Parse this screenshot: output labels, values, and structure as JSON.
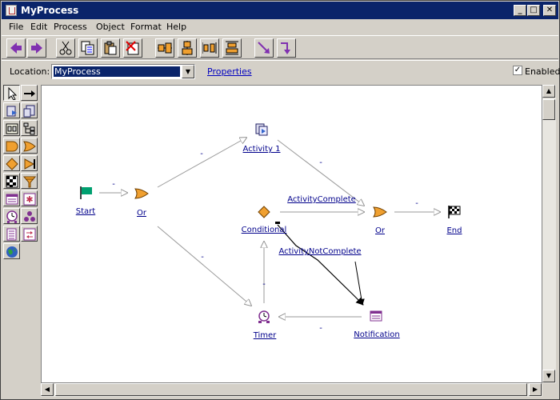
{
  "window": {
    "title": "MyProcess"
  },
  "menu": [
    "File",
    "Edit",
    "Process",
    "Object",
    "Format",
    "Help"
  ],
  "toolbar": {
    "buttons": [
      "back-icon",
      "forward-icon",
      "cut-icon",
      "copy-icon",
      "paste-icon",
      "delete-icon",
      "align-horizontal-icon",
      "align-vertical-icon",
      "distribute-horizontal-icon",
      "distribute-vertical-icon",
      "connector-straight-icon",
      "connector-orthogonal-icon"
    ]
  },
  "location": {
    "label": "Location:",
    "value": "MyProcess",
    "properties_link": "Properties",
    "enabled_label": "Enabled",
    "enabled_checked": true
  },
  "palette": [
    "select-tool-icon",
    "arrow-tool-icon",
    "activity-tool-icon",
    "subprocess-tool-icon",
    "group-tool-icon",
    "tree-tool-icon",
    "and-tool-icon",
    "or-tool-icon",
    "conditional-tool-icon",
    "end-tool-icon",
    "checkered-tool-icon",
    "filter-tool-icon",
    "form-tool-icon",
    "star-tool-icon",
    "timer-tool-icon",
    "people-tool-icon",
    "list-tool-icon",
    "transfer-tool-icon",
    "globe-tool-icon"
  ],
  "diagram": {
    "nodes": {
      "start": "Start",
      "or1": "Or",
      "activity1": "Activity 1",
      "conditional": "Conditional",
      "or2": "Or",
      "end": "End",
      "timer": "Timer",
      "notification": "Notification"
    },
    "edges": {
      "start_or1": "-",
      "or1_activity1": "-",
      "activity1_or2": "-",
      "conditional_or2": "ActivityComplete",
      "or2_end": "-",
      "or1_timer": "-",
      "conditional_notification": "ActivityNotComplete",
      "timer_conditional": "-",
      "notification_timer": "-"
    }
  },
  "colors": {
    "titlebar": "#0a246a",
    "link": "#00008b",
    "or_gateway": "#f0a030",
    "conditional": "#f0a030",
    "start_flag": "#009060"
  }
}
